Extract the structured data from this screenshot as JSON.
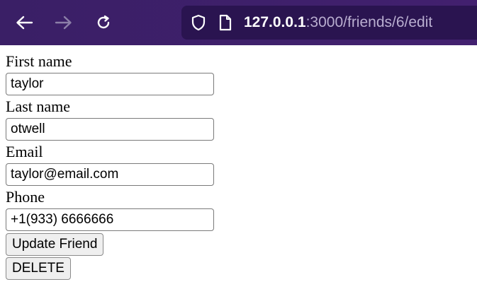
{
  "browser": {
    "url_host": "127.0.0.1",
    "url_path": ":3000/friends/6/edit"
  },
  "form": {
    "first_name_label": "First name",
    "first_name_value": "taylor",
    "last_name_label": "Last name",
    "last_name_value": "otwell",
    "email_label": "Email",
    "email_value": "taylor@email.com",
    "phone_label": "Phone",
    "phone_value": "+1(933) 6666666",
    "update_label": "Update Friend",
    "delete_label": "DELETE"
  },
  "icons": {
    "back": "back-arrow-icon",
    "forward": "forward-arrow-icon",
    "reload": "reload-icon",
    "shield": "shield-icon",
    "page": "page-icon"
  },
  "colors": {
    "toolbar": "#3a1f66",
    "urlbar": "#2a1450"
  }
}
